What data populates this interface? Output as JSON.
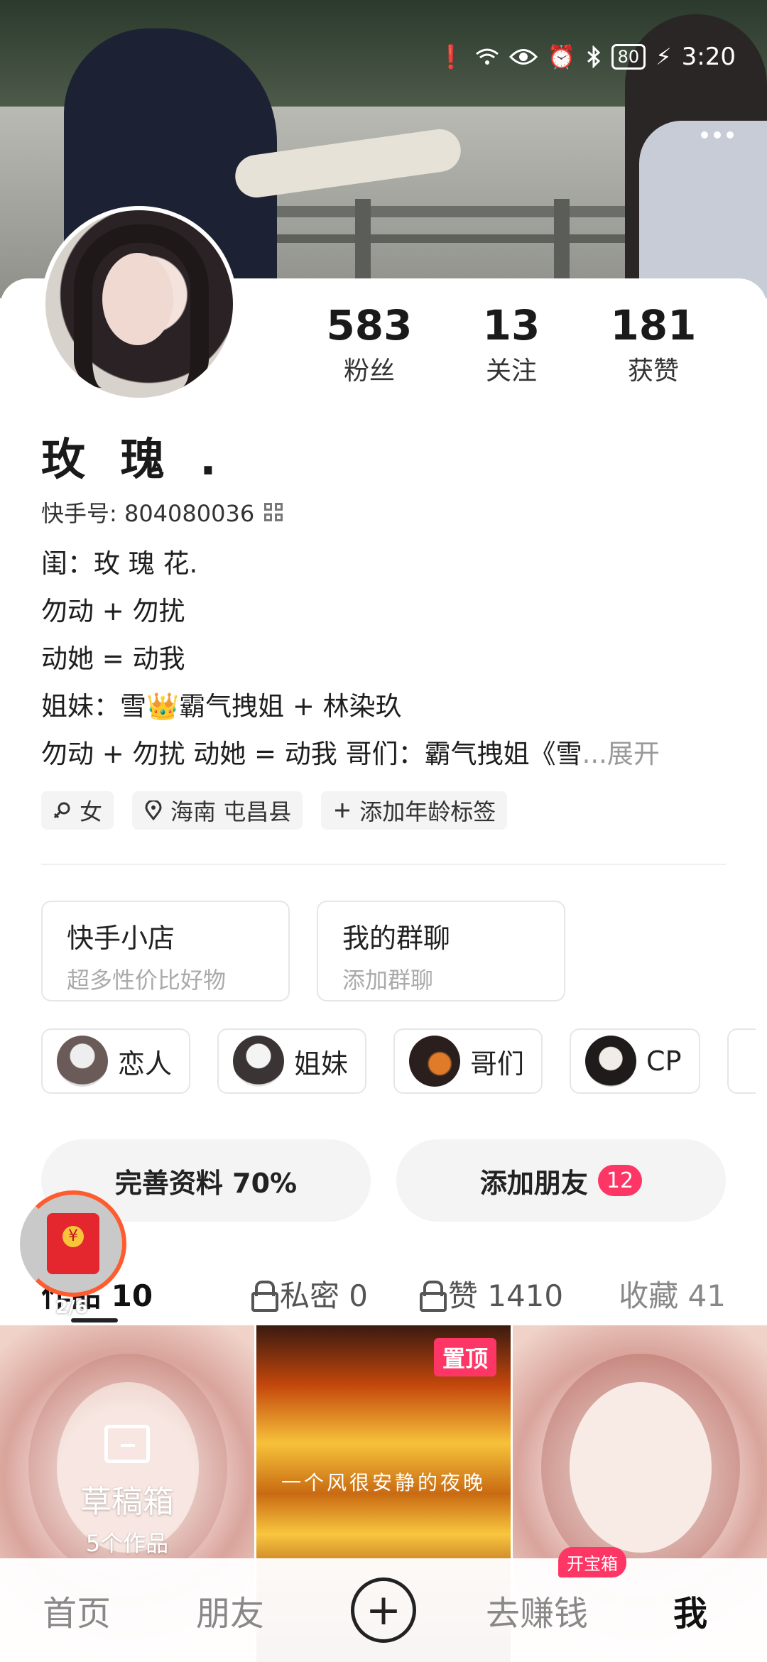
{
  "status_bar": {
    "battery": "80",
    "time": "3:20"
  },
  "profile": {
    "stats": [
      {
        "value": "583",
        "label": "粉丝"
      },
      {
        "value": "13",
        "label": "关注"
      },
      {
        "value": "181",
        "label": "获赞"
      }
    ],
    "nickname": "玫 瑰 .",
    "kuaishou_id": "快手号: 804080036",
    "bio_lines": [
      "闺：玫 瑰 花.",
      "勿动 + 勿扰",
      "动她 = 动我",
      "姐妹：雪👑霸气拽姐 + 林染玖",
      "勿动 + 勿扰 动她 = 动我 哥们：霸气拽姐《雪"
    ],
    "bio_ellipsis": "...",
    "bio_expand": "展开",
    "tags": [
      "女",
      "海南 屯昌县",
      "添加年龄标签"
    ]
  },
  "shops": [
    {
      "title": "快手小店",
      "subtitle": "超多性价比好物"
    },
    {
      "title": "我的群聊",
      "subtitle": "添加群聊"
    }
  ],
  "relations": [
    "恋人",
    "姐妹",
    "哥们",
    "CP"
  ],
  "actions": {
    "complete_profile": "完善资料 70%",
    "add_friends": "添加朋友",
    "add_friends_badge": "12"
  },
  "red_packet": {
    "progress": "2/6"
  },
  "tabs": [
    {
      "label": "作品 10"
    },
    {
      "label": "私密 0"
    },
    {
      "label": "赞 1410"
    },
    {
      "label": "收藏 41"
    }
  ],
  "grid": {
    "draft_title": "草稿箱",
    "draft_count": "5个作品",
    "pinned_label": "置顶",
    "poem_text": "一个风很安静的夜晚"
  },
  "bottom_nav": {
    "home": "首页",
    "friends": "朋友",
    "earn": "去赚钱",
    "earn_badge": "开宝箱",
    "me": "我"
  },
  "colors": {
    "accent": "#fe3666",
    "packet_ring": "#ff5b2e"
  }
}
